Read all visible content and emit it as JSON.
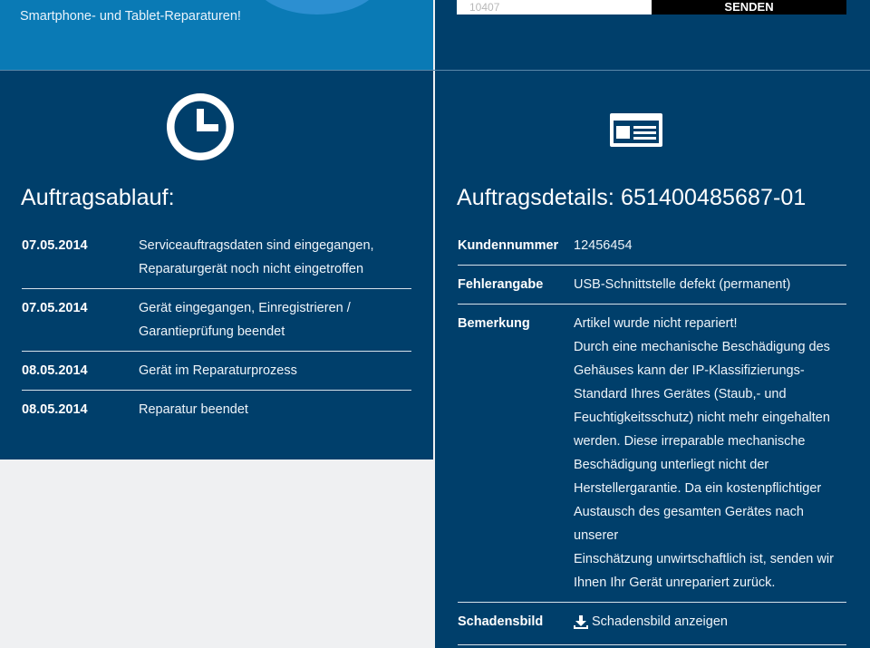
{
  "promo": {
    "prev_text": "",
    "text": "Smartphone- und Tablet-Reparaturen!"
  },
  "form": {
    "input_value": "10407",
    "button_label": "SENDEN",
    "button_arrow": "›"
  },
  "order_process": {
    "icon": "clock-icon",
    "title": "Auftragsablauf:",
    "rows": [
      {
        "date": "07.05.2014",
        "text": "Serviceauftragsdaten sind eingegangen,\nReparaturgerät noch nicht eingetroffen"
      },
      {
        "date": "07.05.2014",
        "text": "Gerät eingegangen, Einregistrieren /\nGarantieprüfung beendet"
      },
      {
        "date": "08.05.2014",
        "text": "Gerät im Reparaturprozess"
      },
      {
        "date": "08.05.2014",
        "text": "Reparatur beendet"
      }
    ]
  },
  "order_details": {
    "icon": "id-card-icon",
    "title": "Auftragsdetails: 651400485687-01",
    "rows": [
      {
        "key": "Kundennummer",
        "value": "12456454"
      },
      {
        "key": "Fehlerangabe",
        "value": "USB-Schnittstelle defekt (permanent)"
      },
      {
        "key": "Bemerkung",
        "value": "Artikel wurde nicht repariert!\nDurch eine mechanische Beschädigung des\nGehäuses kann der IP-Klassifizierungs-\nStandard Ihres Gerätes (Staub,- und\nFeuchtigkeitsschutz) nicht mehr eingehalten\nwerden. Diese irreparable mechanische\nBeschädigung unterliegt nicht der\nHerstellergarantie. Da ein kostenpflichtiger\nAustausch des gesamten Gerätes nach unserer\nEinschätzung unwirtschaftlich ist, senden wir\nIhnen Ihr Gerät unrepariert zurück."
      },
      {
        "key": "Schadensbild",
        "link_label": "Schadensbild anzeigen",
        "link_icon": "download-icon"
      }
    ]
  },
  "colors": {
    "panel": "#003f6b",
    "promo": "#0a7ab5",
    "background": "#eff0f2"
  }
}
